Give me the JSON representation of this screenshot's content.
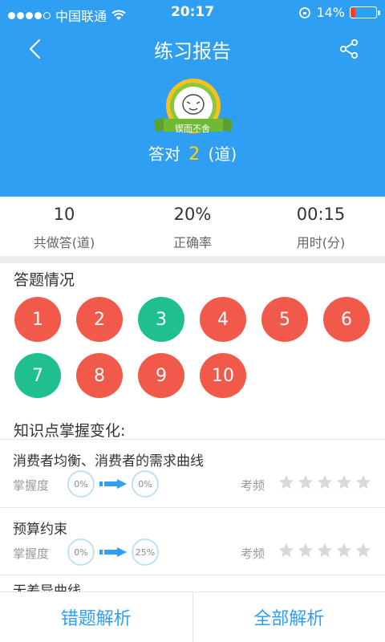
{
  "status_bar": {
    "carrier": "中国联通",
    "time": "20:17",
    "battery": "14%"
  },
  "header": {
    "title": "练习报告",
    "badge_text": "锲而不舍",
    "score_prefix": "答对",
    "score_value": "2",
    "score_suffix": "(道)"
  },
  "stats": [
    {
      "value": "10",
      "label": "共做答(道)"
    },
    {
      "value": "20%",
      "label": "正确率"
    },
    {
      "value": "00:15",
      "label": "用时(分)"
    }
  ],
  "answers_section": {
    "title": "答题情况",
    "items": [
      {
        "num": "1",
        "status": "wrong"
      },
      {
        "num": "2",
        "status": "wrong"
      },
      {
        "num": "3",
        "status": "correct"
      },
      {
        "num": "4",
        "status": "wrong"
      },
      {
        "num": "5",
        "status": "wrong"
      },
      {
        "num": "6",
        "status": "wrong"
      },
      {
        "num": "7",
        "status": "correct"
      },
      {
        "num": "8",
        "status": "wrong"
      },
      {
        "num": "9",
        "status": "wrong"
      },
      {
        "num": "10",
        "status": "wrong"
      }
    ],
    "colors": {
      "wrong": "#f15a4a",
      "correct": "#1fbf8f"
    }
  },
  "knowledge": {
    "title": "知识点掌握变化:",
    "mastery_label": "掌握度",
    "freq_label": "考频",
    "items": [
      {
        "name": "消费者均衡、消费者的需求曲线",
        "from": "0%",
        "to": "0%",
        "stars": 0
      },
      {
        "name": "预算约束",
        "from": "0%",
        "to": "25%",
        "stars": 0
      },
      {
        "name": "无差异曲线",
        "from": "",
        "to": "",
        "stars": 0
      }
    ]
  },
  "footer": {
    "wrong_analysis": "错题解析",
    "all_analysis": "全部解析"
  },
  "accent_color": "#2f9ff3"
}
